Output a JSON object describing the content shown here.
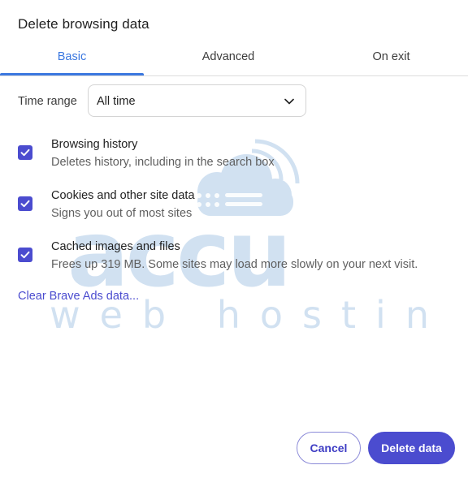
{
  "dialog": {
    "title": "Delete browsing data"
  },
  "tabs": [
    {
      "label": "Basic",
      "active": true
    },
    {
      "label": "Advanced",
      "active": false
    },
    {
      "label": "On exit",
      "active": false
    }
  ],
  "time_range": {
    "label": "Time range",
    "selected": "All time"
  },
  "options": [
    {
      "title": "Browsing history",
      "subtitle": "Deletes history, including in the search box",
      "checked": true
    },
    {
      "title": "Cookies and other site data",
      "subtitle": "Signs you out of most sites",
      "checked": true
    },
    {
      "title": "Cached images and files",
      "subtitle": "Frees up 319 MB. Some sites may load more slowly on your next visit.",
      "checked": true
    }
  ],
  "link": {
    "label": "Clear Brave Ads data..."
  },
  "buttons": {
    "cancel": "Cancel",
    "delete": "Delete data"
  },
  "watermark": {
    "line1": "accu",
    "line2": "web hosting"
  },
  "icons": {
    "dropdown": "chevron-down-icon",
    "checkbox": "checkmark-icon",
    "watermark_cloud": "cloud-signal-icon"
  },
  "colors": {
    "accent": "#4b4ccf",
    "tab_active": "#3b78e0",
    "watermark": "#c9dcef"
  }
}
